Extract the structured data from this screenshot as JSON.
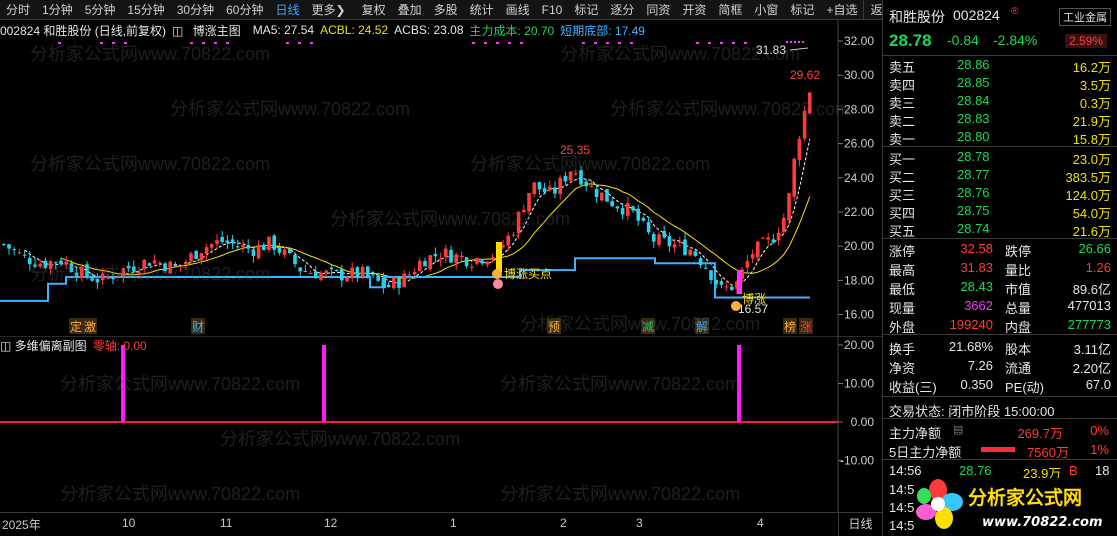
{
  "toolbar": {
    "items": [
      "分时",
      "1分钟",
      "5分钟",
      "15分钟",
      "30分钟",
      "60分钟",
      "日线",
      "更多"
    ],
    "active": "日线",
    "tools": [
      "复权",
      "叠加",
      "多股",
      "统计",
      "画线",
      "F10",
      "标记",
      "逐分",
      "同资",
      "开资",
      "简框",
      "小窗",
      "标记",
      "+自选",
      "返回"
    ]
  },
  "legend": {
    "stock": "002824 和胜股份 (日线,前复权)",
    "indicator": "博涨主图",
    "ma5": "MA5: 27.54",
    "acbl": "ACBL: 24.52",
    "acbs": "ACBS: 23.08",
    "cost": "主力成本: 20.70",
    "bottom": "短期底部: 17.49"
  },
  "sub_legend": {
    "name": "多维偏离副图",
    "zero": "零轴: 0.00"
  },
  "chart_annotations": {
    "high1": "25.35",
    "high2": "31.83",
    "last": "29.62",
    "low": "16.57",
    "buy1": "博涨买点",
    "buy2": "博涨",
    "bottom_tags": [
      "定",
      "激",
      "财",
      "预",
      "减",
      "解",
      "榜",
      "涨"
    ]
  },
  "chart_data": {
    "type": "bar",
    "main_yaxis": [
      "32.00",
      "30.00",
      "28.00",
      "26.00",
      "24.00",
      "22.00",
      "20.00",
      "18.00",
      "16.00"
    ],
    "sub_yaxis": [
      "20.00",
      "10.00",
      "0.00",
      "-10.00"
    ],
    "sub_series": [
      {
        "name": "多维偏离副图",
        "x": [
          "2024-10-08",
          "2024-12-03",
          "2025-03-27"
        ],
        "values": [
          20.0,
          20.0,
          20.0
        ]
      }
    ],
    "xaxis": [
      "2025年",
      "10",
      "11",
      "12",
      "1",
      "2",
      "3",
      "4"
    ]
  },
  "period": "日线",
  "panel": {
    "name": "和胜股份",
    "code": "002824",
    "industry": "工业金属",
    "price": "28.78",
    "change": "-0.84",
    "pct": "-2.84%",
    "amp": "2.59%",
    "asks": [
      {
        "label": "卖五",
        "price": "28.86",
        "vol": "16.2万"
      },
      {
        "label": "卖四",
        "price": "28.85",
        "vol": "3.5万"
      },
      {
        "label": "卖三",
        "price": "28.84",
        "vol": "0.3万"
      },
      {
        "label": "卖二",
        "price": "28.83",
        "vol": "21.9万"
      },
      {
        "label": "卖一",
        "price": "28.80",
        "vol": "15.8万"
      }
    ],
    "bids": [
      {
        "label": "买一",
        "price": "28.78",
        "vol": "23.0万"
      },
      {
        "label": "买二",
        "price": "28.77",
        "vol": "383.5万"
      },
      {
        "label": "买三",
        "price": "28.76",
        "vol": "124.0万"
      },
      {
        "label": "买四",
        "price": "28.75",
        "vol": "54.0万"
      },
      {
        "label": "买五",
        "price": "28.74",
        "vol": "21.6万"
      }
    ],
    "stats": [
      {
        "l1": "涨停",
        "v1": "32.58",
        "l2": "跌停",
        "v2": "26.66"
      },
      {
        "l1": "最高",
        "v1": "31.83",
        "l2": "量比",
        "v2": "1.26"
      },
      {
        "l1": "最低",
        "v1": "28.43",
        "l2": "市值",
        "v2": "89.6亿"
      },
      {
        "l1": "现量",
        "v1": "3662",
        "l2": "总量",
        "v2": "477013"
      },
      {
        "l1": "外盘",
        "v1": "199240",
        "l2": "内盘",
        "v2": "277773"
      }
    ],
    "stats2": [
      {
        "l1": "换手",
        "v1": "21.68%",
        "l2": "股本",
        "v2": "3.11亿"
      },
      {
        "l1": "净资",
        "v1": "7.26",
        "l2": "流通",
        "v2": "2.20亿"
      },
      {
        "l1": "收益(三)",
        "v1": "0.350",
        "l2": "PE(动)",
        "v2": "67.0"
      }
    ],
    "trade_status": "交易状态: 闭市阶段 15:00:00",
    "flow1_label": "主力净额",
    "flow1_val": "269.7万",
    "flow1_pct": "0%",
    "flow2_label": "5日主力净额",
    "flow2_val": "7560万",
    "flow2_pct": "1%",
    "tick_time": "14:56",
    "tick_price": "28.76",
    "tick_vol": "23.9万",
    "tick_side": "B",
    "tick_num": "18",
    "tick_times": [
      "14:5",
      "14:5",
      "14:5"
    ]
  },
  "logo": {
    "title": "分析家公式网",
    "url": "www.70822.com"
  },
  "watermark": "分析家公式网www.70822.com"
}
